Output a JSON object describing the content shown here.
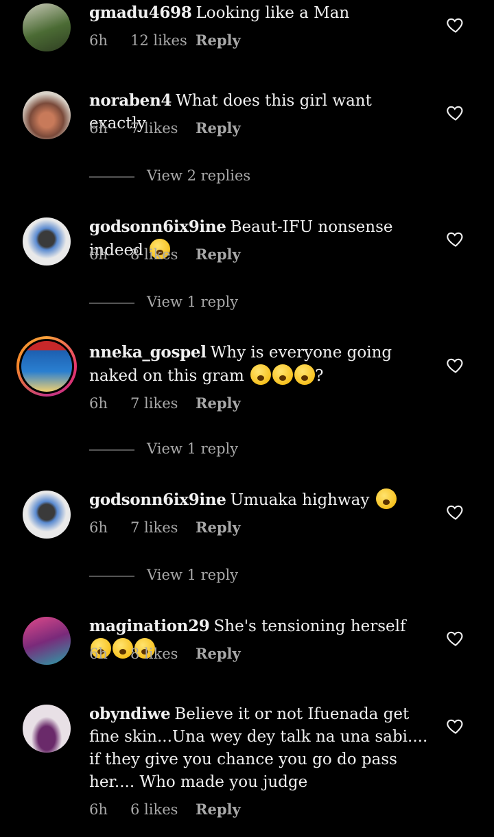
{
  "reply_label": "Reply",
  "comments": [
    {
      "user": "gmadu4698",
      "text": "Looking like a Man",
      "time": "6h",
      "likes": "12 likes",
      "avatar_color": "#3b5a2a"
    },
    {
      "user": "noraben4",
      "text": "What does this girl want exactly",
      "time": "6h",
      "likes": "7 likes",
      "avatar_color": "#8a6a58",
      "view_replies": "View 2 replies"
    },
    {
      "user": "godsonn6ix9ine",
      "text": "Beaut-IFU nonsense indeed",
      "emoji": "rolling-laughing-emoji",
      "time": "6h",
      "likes": "8 likes",
      "avatar_color": "#e9e9e9",
      "view_replies": "View 1 reply"
    },
    {
      "user": "nneka_gospel",
      "text": "Why is everyone going naked on this gram",
      "emoji_suffix": "?",
      "time": "6h",
      "likes": "7 likes",
      "avatar_color": "#2a4a8a",
      "view_replies": "View 1 reply"
    },
    {
      "user": "godsonn6ix9ine",
      "text": "Umuaka highway",
      "emoji": "tears-of-joy-emoji",
      "time": "6h",
      "likes": "7 likes",
      "avatar_color": "#e9e9e9",
      "view_replies": "View 1 reply"
    },
    {
      "user": "magination29",
      "text": "She's tensioning herself",
      "time": "6h",
      "likes": "8 likes",
      "avatar_color": "#b0386a"
    },
    {
      "user": "obyndiwe",
      "text": "Believe it or not Ifuenada get fine skin...Una wey dey talk na una sabi.... if they give you chance you go do pass her.... Who made you judge",
      "time": "6h",
      "likes": "6 likes",
      "avatar_color": "#e8e0e6"
    }
  ]
}
